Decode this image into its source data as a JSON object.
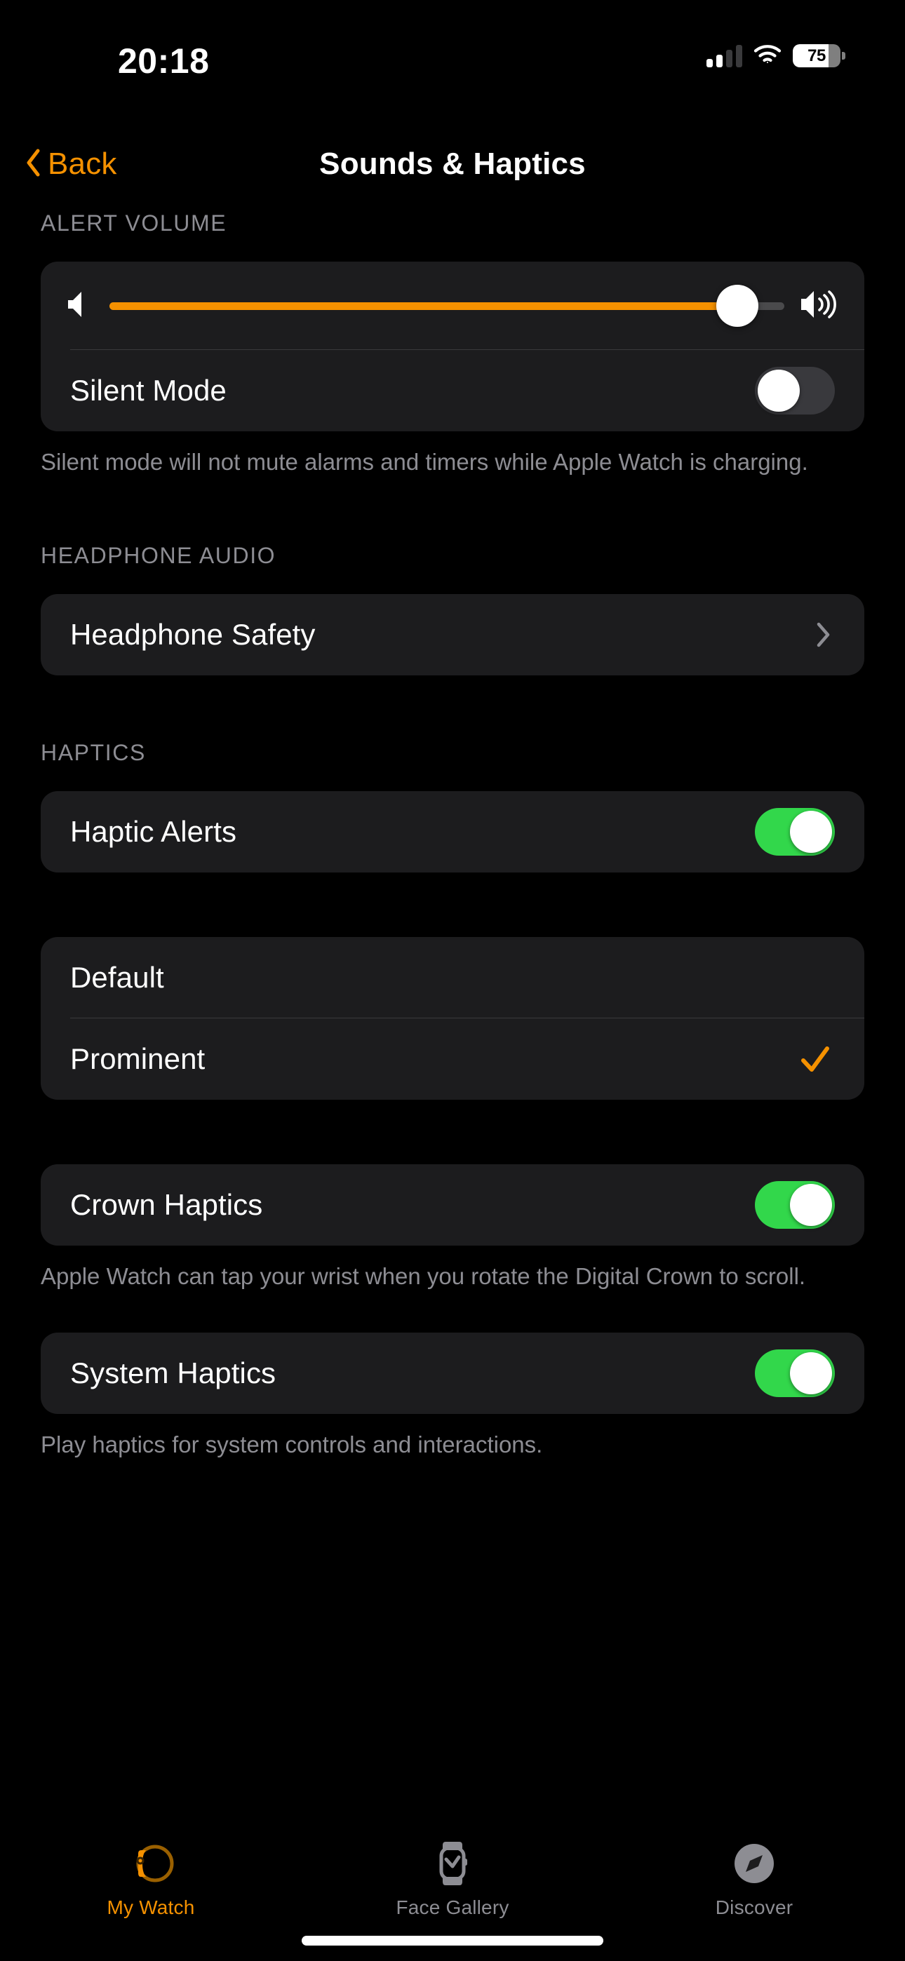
{
  "status_bar": {
    "time": "20:18",
    "cellular_icon": "cellular-signal-icon",
    "cellular_bars_filled": 2,
    "cellular_bars_total": 4,
    "wifi_icon": "wifi-icon",
    "battery_icon": "battery-icon",
    "battery_percent_label": "75",
    "battery_percent": 75
  },
  "nav": {
    "back_icon": "chevron-left-icon",
    "back_label": "Back",
    "title": "Sounds & Haptics"
  },
  "sections": {
    "alert_volume": {
      "header": "ALERT VOLUME",
      "slider": {
        "name": "alert-volume-slider",
        "value": 93,
        "min_icon": "speaker-low-icon",
        "max_icon": "speaker-high-icon"
      },
      "silent_mode": {
        "label": "Silent Mode",
        "toggle_state": "off"
      },
      "footer": "Silent mode will not mute alarms and timers while Apple Watch is charging."
    },
    "headphone_audio": {
      "header": "HEADPHONE AUDIO",
      "headphone_safety": {
        "label": "Headphone Safety",
        "disclosure_icon": "chevron-right-icon"
      }
    },
    "haptics": {
      "header": "HAPTICS",
      "haptic_alerts": {
        "label": "Haptic Alerts",
        "toggle_state": "on"
      },
      "intensity_options": [
        {
          "label": "Default",
          "selected": false
        },
        {
          "label": "Prominent",
          "selected": true,
          "check_icon": "checkmark-icon"
        }
      ],
      "crown_haptics": {
        "label": "Crown Haptics",
        "toggle_state": "on",
        "footer": "Apple Watch can tap your wrist when you rotate the Digital Crown to scroll."
      },
      "system_haptics": {
        "label": "System Haptics",
        "toggle_state": "on",
        "footer": "Play haptics for system controls and interactions."
      }
    }
  },
  "tab_bar": {
    "tabs": [
      {
        "label": "My Watch",
        "icon": "apple-watch-side-icon",
        "active": true
      },
      {
        "label": "Face Gallery",
        "icon": "watch-face-icon",
        "active": false
      },
      {
        "label": "Discover",
        "icon": "compass-icon",
        "active": false
      }
    ]
  },
  "colors": {
    "accent_orange": "#f59100",
    "toggle_on_green": "#32d74b",
    "card_background": "#1c1c1e",
    "secondary_text": "#8d8d93"
  }
}
